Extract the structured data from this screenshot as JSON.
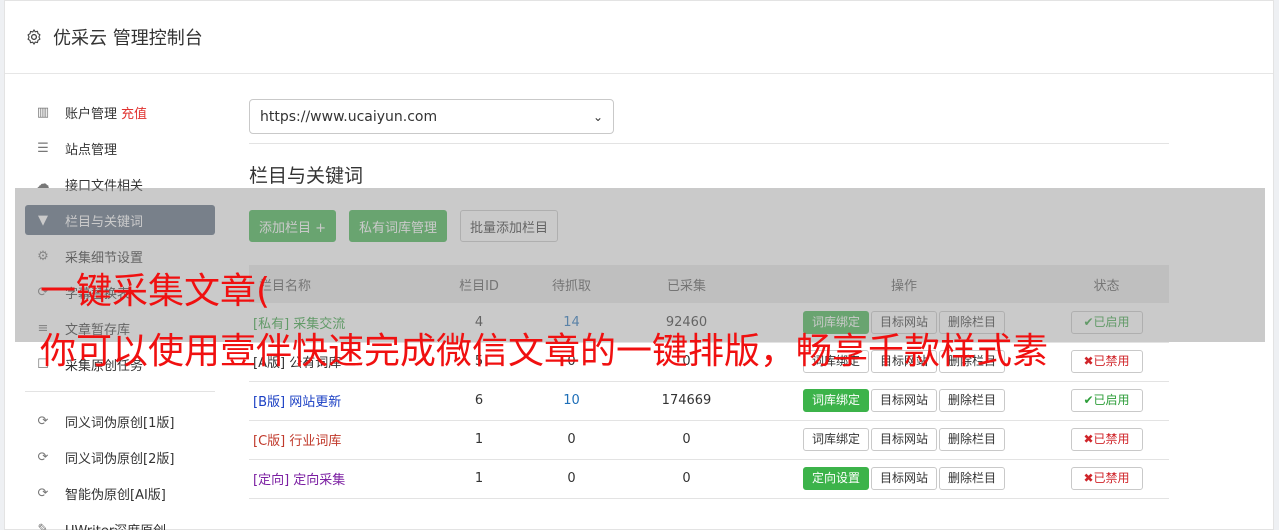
{
  "header": {
    "title": "优采云 管理控制台",
    "icon": "gear-icon"
  },
  "sidebar": {
    "items": [
      {
        "label": "账户管理",
        "extra": "充值",
        "icon": "bar-chart-icon",
        "glyph": "▥"
      },
      {
        "label": "站点管理",
        "icon": "server-icon",
        "glyph": "☰"
      },
      {
        "label": "接口文件相关",
        "icon": "cloud-upload-icon",
        "glyph": "☁"
      },
      {
        "label": "栏目与关键词",
        "icon": "filter-icon",
        "glyph": "▼",
        "active": true
      },
      {
        "label": "采集细节设置",
        "icon": "cogs-icon",
        "glyph": "⚙"
      },
      {
        "label": "字幕替换表",
        "icon": "replace-icon",
        "glyph": "⟳"
      },
      {
        "label": "文章暂存库",
        "icon": "database-icon",
        "glyph": "≡"
      },
      {
        "label": "采集原创任务",
        "icon": "checkbox-icon",
        "glyph": "☐"
      }
    ],
    "items2": [
      {
        "label": "同义词伪原创[1版]",
        "icon": "refresh-icon",
        "glyph": "⟳"
      },
      {
        "label": "同义词伪原创[2版]",
        "icon": "refresh-icon",
        "glyph": "⟳"
      },
      {
        "label": "智能伪原创[AI版]",
        "icon": "refresh-icon",
        "glyph": "⟳"
      },
      {
        "label": "UWriter深度原创",
        "icon": "edit-icon",
        "glyph": "✎"
      }
    ]
  },
  "main": {
    "site_select": {
      "value": "https://www.ucaiyun.com"
    },
    "section_title": "栏目与关键词",
    "buttons": {
      "add_column": "添加栏目 +",
      "private_lib": "私有词库管理",
      "batch_add": "批量添加栏目"
    },
    "table": {
      "headers": {
        "name": "栏目名称",
        "id": "栏目ID",
        "wait": "待抓取",
        "done": "已采集",
        "ops": "操作",
        "status": "状态"
      },
      "rows": [
        {
          "tag": "[私有]",
          "name": "采集交流",
          "id": "4",
          "wait": "14",
          "done": "92460",
          "op1": "词库绑定",
          "op1_green": true,
          "op2": "目标网站",
          "op3": "删除栏目",
          "status": "✔已启用",
          "status_on": true,
          "color": "#2e9e3a"
        },
        {
          "tag": "[A版]",
          "name": "公有词库",
          "id": "5",
          "wait": "0",
          "done": "0",
          "op1": "词库绑定",
          "op1_green": false,
          "op2": "目标网站",
          "op3": "删除栏目",
          "status": "✖已禁用",
          "status_on": false,
          "color": "#333333"
        },
        {
          "tag": "[B版]",
          "name": "网站更新",
          "id": "6",
          "wait": "10",
          "done": "174669",
          "op1": "词库绑定",
          "op1_green": true,
          "op2": "目标网站",
          "op3": "删除栏目",
          "status": "✔已启用",
          "status_on": true,
          "color": "#1a3fc4"
        },
        {
          "tag": "[C版]",
          "name": "行业词库",
          "id": "1",
          "wait": "0",
          "done": "0",
          "op1": "词库绑定",
          "op1_green": false,
          "op2": "目标网站",
          "op3": "删除栏目",
          "status": "✖已禁用",
          "status_on": false,
          "color": "#c0392b"
        },
        {
          "tag": "[定向]",
          "name": "定向采集",
          "id": "1",
          "wait": "0",
          "done": "0",
          "op1": "定向设置",
          "op1_green": true,
          "op2": "目标网站",
          "op3": "删除栏目",
          "status": "✖已禁用",
          "status_on": false,
          "color": "#7b1fa2"
        }
      ]
    }
  },
  "overlay": {
    "caption_line1": "一键采集文章(",
    "caption_line2": "你可以使用壹伴快速完成微信文章的一键排版，畅享千款样式素"
  }
}
